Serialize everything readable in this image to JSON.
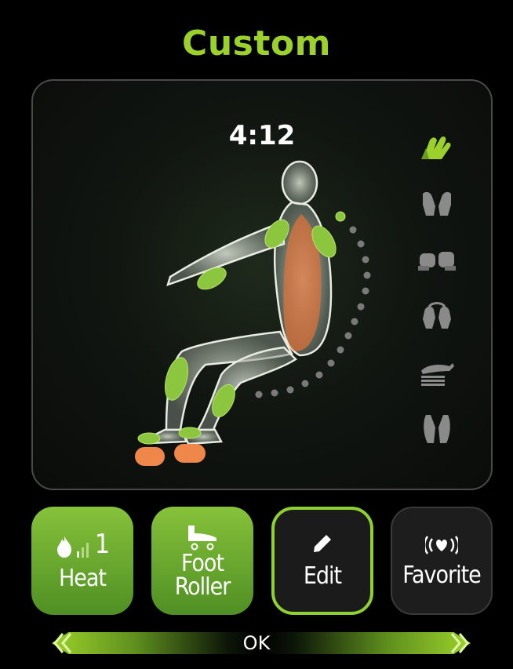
{
  "screen": {
    "title": "Custom"
  },
  "panel": {
    "timer": "4:12"
  },
  "massage_modes": [
    {
      "icon": "kneading-hands-icon",
      "active": true
    },
    {
      "icon": "tapping-hands-icon",
      "active": false
    },
    {
      "icon": "clapping-fists-icon",
      "active": false
    },
    {
      "icon": "shiatsu-hands-icon",
      "active": false
    },
    {
      "icon": "rolling-hand-icon",
      "active": false
    },
    {
      "icon": "knocking-hands-icon",
      "active": false
    }
  ],
  "buttons": {
    "heat": {
      "level": "1",
      "label": "Heat"
    },
    "foot_roller": {
      "label_line1": "Foot",
      "label_line2": "Roller"
    },
    "edit": {
      "label": "Edit"
    },
    "favorite": {
      "label": "Favorite"
    }
  },
  "ok_bar": {
    "label": "OK"
  },
  "colors": {
    "accent": "#9bd12a",
    "airbag": "#8cc63f",
    "roller": "#f0874a",
    "background": "#000000"
  }
}
